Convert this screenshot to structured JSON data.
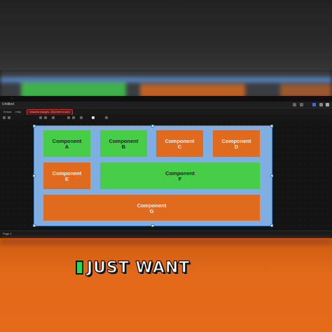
{
  "app": {
    "tabbar": {
      "items": [
        "",
        "+"
      ]
    },
    "toolbar": {
      "title": "Untitled"
    },
    "menubar": {
      "items": [
        "Extras",
        "Help"
      ],
      "warning": "Unsaved changes. Click here to save"
    },
    "page_tab": "Page-1"
  },
  "components": [
    {
      "name": "Component",
      "letter": "A",
      "color": "#48cd48"
    },
    {
      "name": "Component",
      "letter": "B",
      "color": "#48cd48"
    },
    {
      "name": "Component",
      "letter": "C",
      "color": "#e06b1e"
    },
    {
      "name": "Component",
      "letter": "D",
      "color": "#e06b1e"
    },
    {
      "name": "Component",
      "letter": "E",
      "color": "#e06b1e"
    },
    {
      "name": "Component",
      "letter": "F",
      "color": "#48cd48"
    },
    {
      "name": "Component",
      "letter": "G",
      "color": "#e06b1e"
    }
  ],
  "frame_color": "#7faee3",
  "caption": {
    "text": "JUST WANT",
    "cursor_color": "#2fd35a"
  }
}
